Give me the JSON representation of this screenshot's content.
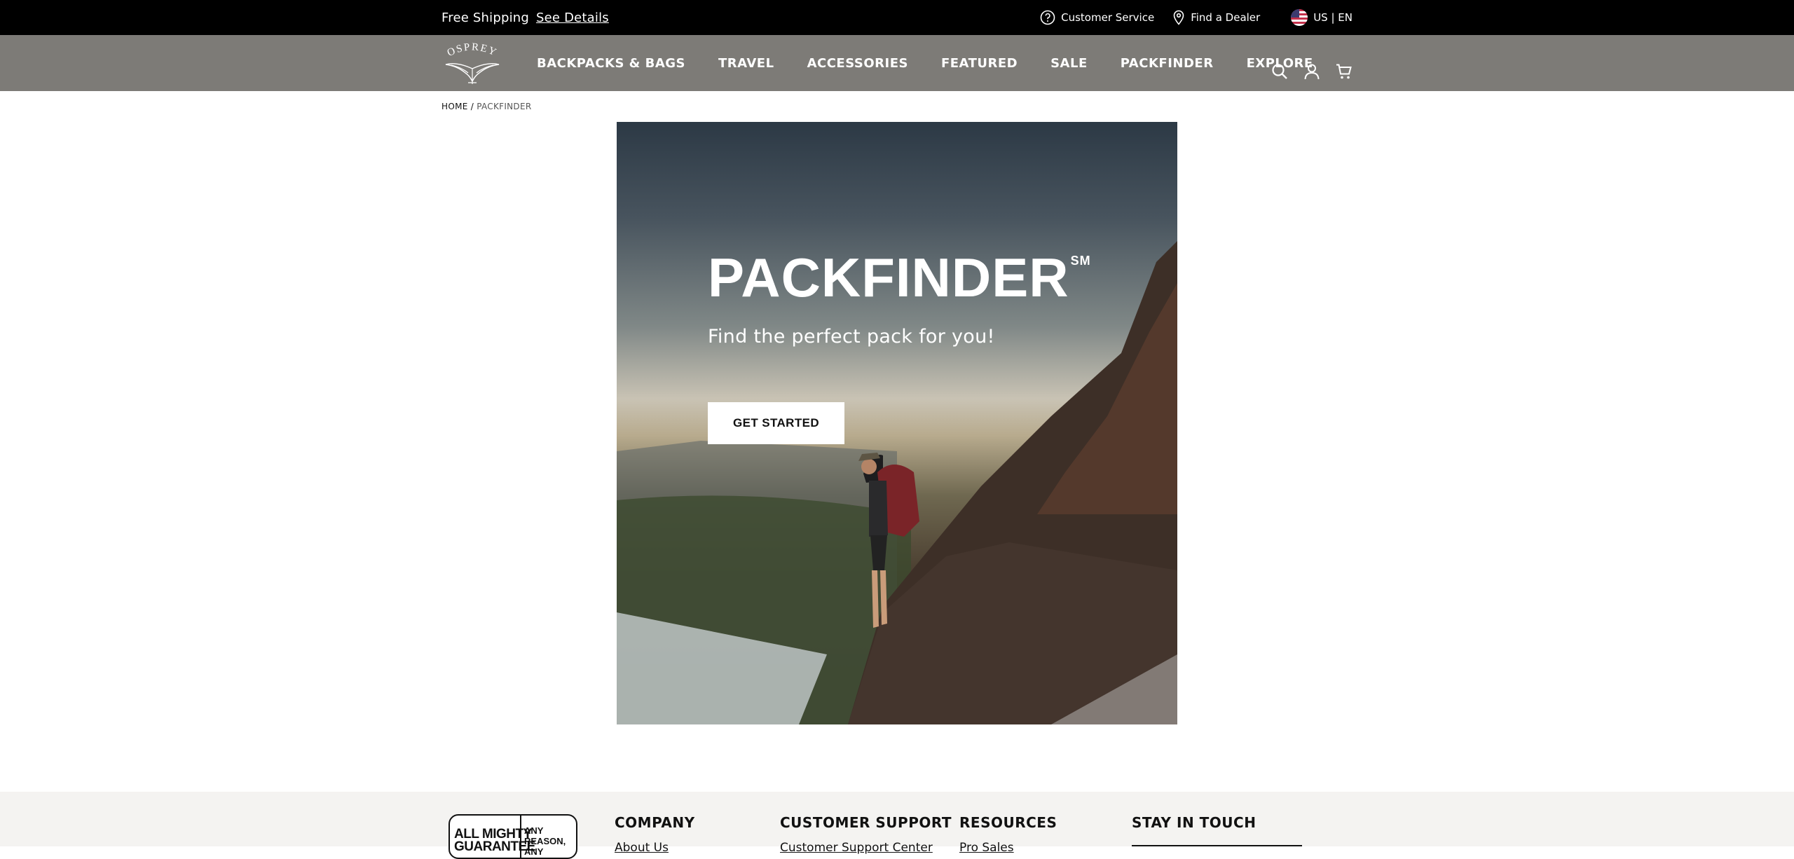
{
  "topbar": {
    "shipping_text": "Free Shipping",
    "shipping_link": "See Details",
    "customer_service": "Customer Service",
    "find_dealer": "Find a Dealer",
    "locale": "US | EN"
  },
  "nav": {
    "logo_text": "OSPREY",
    "items": [
      "BACKPACKS & BAGS",
      "TRAVEL",
      "ACCESSORIES",
      "FEATURED",
      "SALE",
      "PACKFINDER",
      "EXPLORE"
    ]
  },
  "breadcrumb": {
    "home": "HOME",
    "separator": "/",
    "current": "PACKFINDER"
  },
  "hero": {
    "title": "PACKFINDER",
    "title_mark": "SM",
    "subtitle": "Find the perfect pack for you!",
    "cta": "GET STARTED"
  },
  "footer": {
    "guarantee_left": "ALL MIGHTY GUARANTEE",
    "guarantee_right": "ANY REASON, ANY PRODUCT",
    "columns": [
      {
        "title": "COMPANY",
        "first_link": "About Us"
      },
      {
        "title": "CUSTOMER SUPPORT",
        "first_link": "Customer Support Center"
      },
      {
        "title": "RESOURCES",
        "first_link": "Pro Sales"
      },
      {
        "title": "STAY IN TOUCH",
        "first_link": ""
      }
    ]
  },
  "colors": {
    "topbar": "#000000",
    "navbar": "#7d7b77",
    "footer": "#f4f3f1"
  }
}
